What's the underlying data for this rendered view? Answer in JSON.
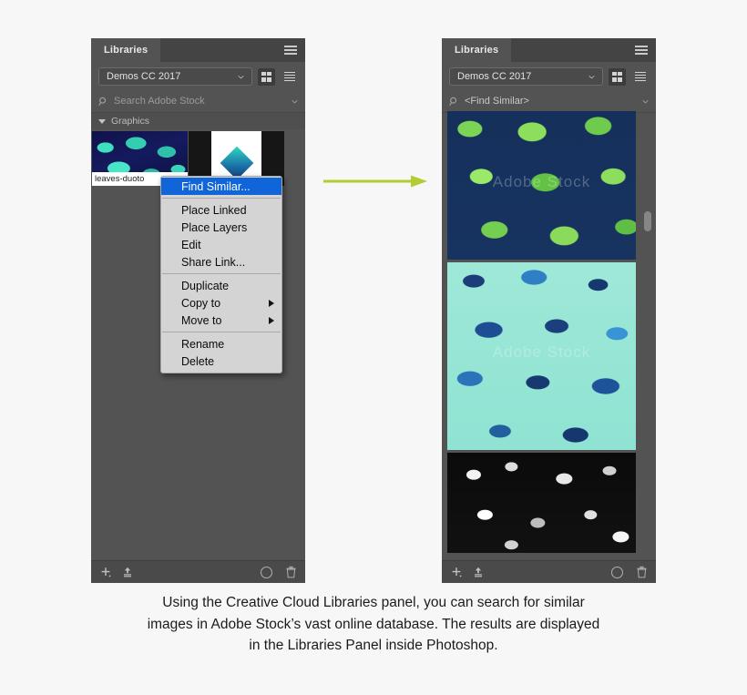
{
  "left_panel": {
    "tab_label": "Libraries",
    "menu_icon": "hamburger-icon",
    "library_select": {
      "value": "Demos CC 2017",
      "chevron": "chevron-down-icon"
    },
    "view_grid_icon": "grid-view-icon",
    "view_list_icon": "list-view-icon",
    "search": {
      "icon": "search-icon",
      "placeholder": "Search Adobe Stock",
      "value": "",
      "chevron": "chevron-down-icon"
    },
    "group_header": "Graphics",
    "items": [
      {
        "label": "leaves-duoto",
        "art": "duotone-leaves"
      },
      {
        "label": "",
        "art": "card-gem"
      }
    ],
    "bottom_bar": {
      "add_icon": "add-content-icon",
      "upload_icon": "upload-icon",
      "cc_icon": "creative-cloud-icon",
      "delete_icon": "trash-icon"
    }
  },
  "context_menu": {
    "items": [
      {
        "label": "Find Similar...",
        "selected": true,
        "submenu": false
      },
      {
        "separator": true
      },
      {
        "label": "Place Linked",
        "selected": false,
        "submenu": false
      },
      {
        "label": "Place Layers",
        "selected": false,
        "submenu": false
      },
      {
        "label": "Edit",
        "selected": false,
        "submenu": false
      },
      {
        "label": "Share Link...",
        "selected": false,
        "submenu": false
      },
      {
        "separator": true
      },
      {
        "label": "Duplicate",
        "selected": false,
        "submenu": false
      },
      {
        "label": "Copy to",
        "selected": false,
        "submenu": true
      },
      {
        "label": "Move to",
        "selected": false,
        "submenu": true
      },
      {
        "separator": true
      },
      {
        "label": "Rename",
        "selected": false,
        "submenu": false
      },
      {
        "label": "Delete",
        "selected": false,
        "submenu": false
      }
    ],
    "highlight_color": "#1066d8"
  },
  "flow_arrow": {
    "name": "flow-arrow",
    "color": "#b3cc33"
  },
  "right_panel": {
    "tab_label": "Libraries",
    "menu_icon": "hamburger-icon",
    "library_select": {
      "value": "Demos CC 2017",
      "chevron": "chevron-down-icon"
    },
    "view_grid_icon": "grid-view-icon",
    "view_list_icon": "list-view-icon",
    "search": {
      "icon": "search-icon",
      "placeholder": "Search Adobe Stock",
      "value": "<Find Similar>",
      "chevron": "chevron-down-icon"
    },
    "results": [
      {
        "art": "green-monstera-on-navy",
        "watermark": "Adobe Stock"
      },
      {
        "art": "blue-tropical-on-mint",
        "watermark": "Adobe Stock"
      },
      {
        "art": "bw-floral-engraving",
        "watermark": ""
      }
    ],
    "bottom_bar": {
      "add_icon": "add-content-icon",
      "upload_icon": "upload-icon",
      "cc_icon": "creative-cloud-icon",
      "delete_icon": "trash-icon"
    }
  },
  "caption": {
    "line1": "Using the Creative Cloud Libraries panel, you can search for similar",
    "line2": "images in Adobe Stock’s vast online database. The results are displayed",
    "line3": "in the Libraries Panel inside Photoshop."
  }
}
